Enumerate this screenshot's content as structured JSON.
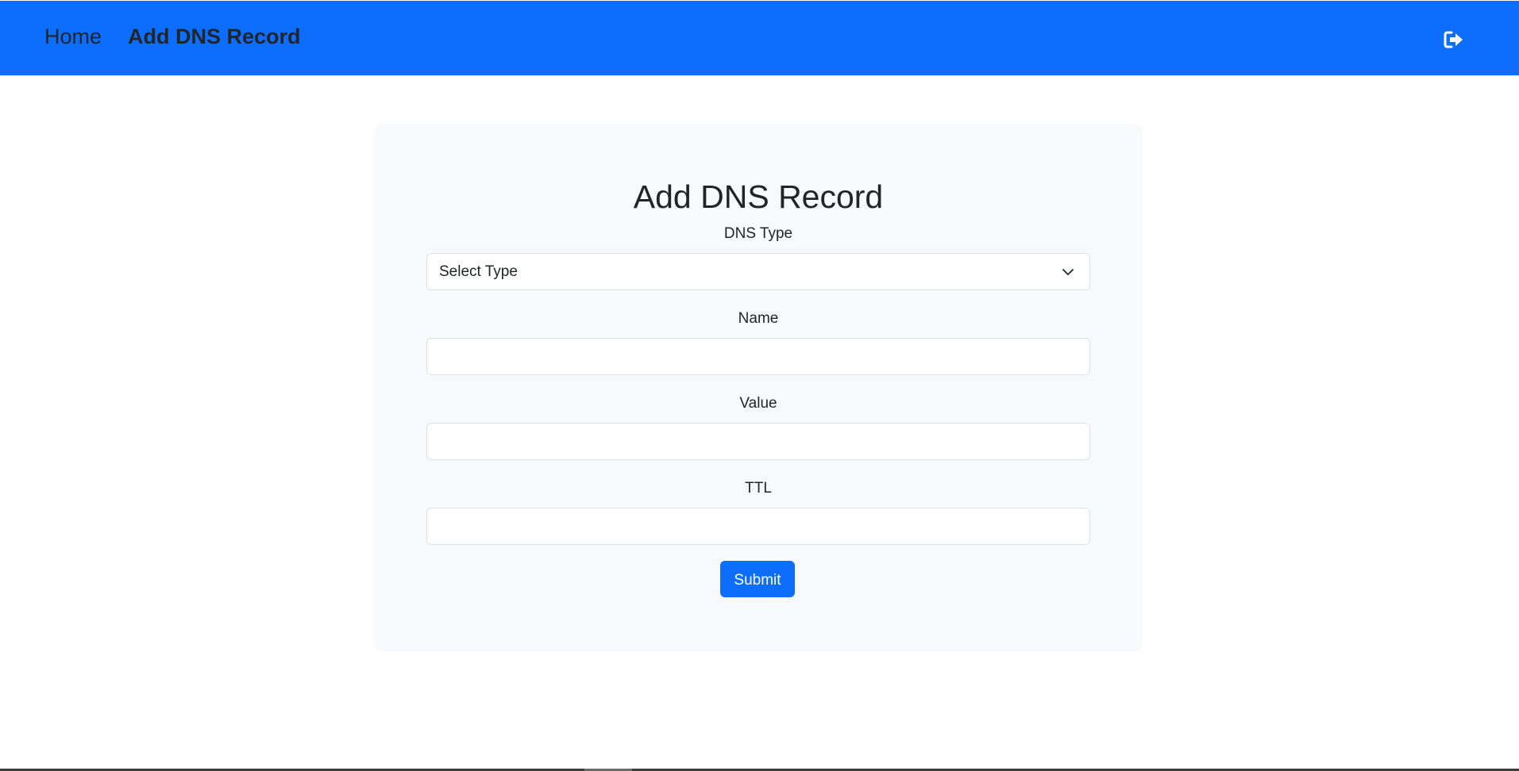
{
  "navbar": {
    "home_label": "Home",
    "active_label": "Add DNS Record",
    "background_color": "#0d6efd",
    "logout_icon": "logout-icon"
  },
  "form": {
    "title": "Add DNS Record",
    "dns_type": {
      "label": "DNS Type",
      "selected_value": "Select Type"
    },
    "name": {
      "label": "Name",
      "value": ""
    },
    "value": {
      "label": "Value",
      "value": ""
    },
    "ttl": {
      "label": "TTL",
      "value": ""
    },
    "submit_label": "Submit"
  },
  "colors": {
    "primary": "#0d6efd",
    "card_background": "#f8f9fc",
    "text": "#212529",
    "input_border": "#dee2e6"
  }
}
